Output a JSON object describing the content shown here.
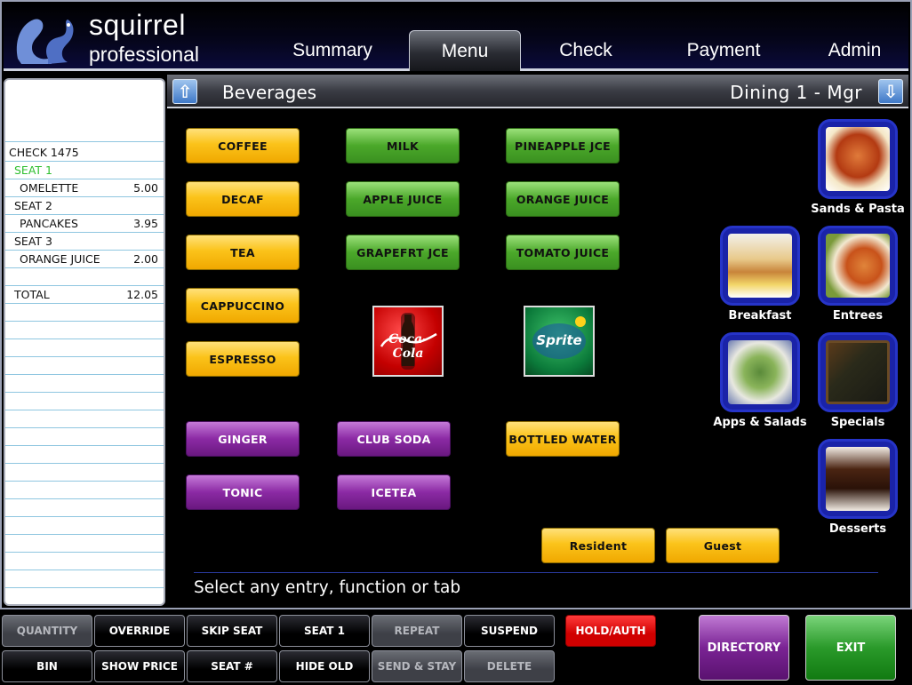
{
  "app": {
    "brand_line1": "squirrel",
    "brand_line2": "professional"
  },
  "nav": {
    "summary": "Summary",
    "menu": "Menu",
    "check": "Check",
    "payment": "Payment",
    "admin": "Admin"
  },
  "menu_header": {
    "category": "Beverages",
    "table": "Dining 1 - Mgr"
  },
  "check": {
    "number": "CHECK 1475",
    "seat1": "SEAT 1",
    "item1": "OMELETTE",
    "item1_price": "5.00",
    "seat2": "SEAT 2",
    "item2": "PANCAKES",
    "item2_price": "3.95",
    "seat3": "SEAT 3",
    "item3": "ORANGE JUICE",
    "item3_price": "2.00",
    "total_label": "TOTAL",
    "total": "12.05"
  },
  "items": {
    "coffee": "COFFEE",
    "decaf": "DECAF",
    "tea": "TEA",
    "cappuccino": "CAPPUCCINO",
    "espresso": "ESPRESSO",
    "milk": "MILK",
    "apple_juice": "APPLE JUICE",
    "grapefruit": "GRAPEFRT JCE",
    "pineapple": "PINEAPPLE JCE",
    "orange_juice": "ORANGE JUICE",
    "tomato_juice": "TOMATO JUICE",
    "ginger": "GINGER",
    "club_soda": "CLUB SODA",
    "bottled_water": "BOTTLED WATER",
    "tonic": "TONIC",
    "icetea": "ICETEA",
    "resident": "Resident",
    "guest": "Guest"
  },
  "logos": {
    "coke": "Coca-Cola",
    "sprite": "Sprite"
  },
  "categories": {
    "sands_pasta": "Sands & Pasta",
    "breakfast": "Breakfast",
    "entrees": "Entrees",
    "apps_salads": "Apps & Salads",
    "specials": "Specials",
    "desserts": "Desserts"
  },
  "status": "Select any entry, function or tab",
  "functions": {
    "quantity": "QUANTITY",
    "override": "OVERRIDE",
    "skip_seat": "SKIP SEAT",
    "seat1": "SEAT 1",
    "repeat": "REPEAT",
    "suspend": "SUSPEND",
    "hold_auth": "HOLD/AUTH",
    "bin": "BIN",
    "show_price": "SHOW PRICE",
    "seat_num": "SEAT #",
    "hide_old": "HIDE OLD",
    "send_stay": "SEND & STAY",
    "delete": "DELETE",
    "directory": "DIRECTORY",
    "exit": "EXIT"
  },
  "colors": {
    "yellow": "#fbc31a",
    "green": "#4ba82a",
    "purple": "#8b2aa4",
    "check_seat": "#2fbf2f",
    "nav_blue": "#1a23a8"
  }
}
